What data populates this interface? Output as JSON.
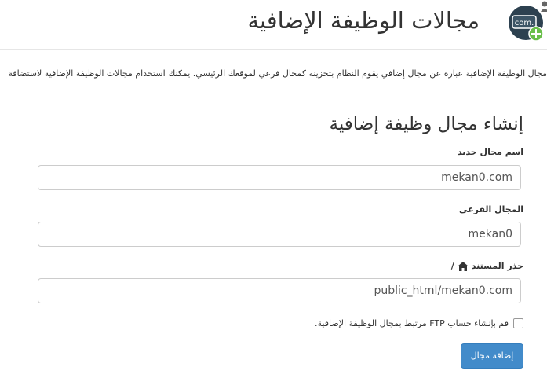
{
  "page": {
    "title": "مجالات الوظيفة الإضافية",
    "description": "مجال الوظيفة الإضافية عبارة عن مجال إضافي يقوم النظام بتخزينه كمجال فرعي لموقعك الرئيسي. يمكنك استخدام مجالات الوظيفة الإضافية لاستضافة"
  },
  "form": {
    "section_title": "إنشاء مجال وظيفة إضافية",
    "new_domain": {
      "label": "اسم مجال جديد",
      "value": "mekan0.com"
    },
    "subdomain": {
      "label": "المجال الفرعي",
      "value": "mekan0"
    },
    "document_root": {
      "label": "جذر المستند",
      "suffix": "/",
      "value": "public_html/mekan0.com"
    },
    "ftp_checkbox": {
      "label": "قم بإنشاء حساب FTP مرتبط بمجال الوظيفة الإضافية.",
      "checked": false
    },
    "submit_label": "إضافة مجال"
  },
  "colors": {
    "primary": "#428bca",
    "icon_bg": "#2d4150",
    "plus": "#6abf4b"
  },
  "icons": {
    "title": "addon-domain-icon",
    "home": "home-icon",
    "user": "user-icon"
  }
}
